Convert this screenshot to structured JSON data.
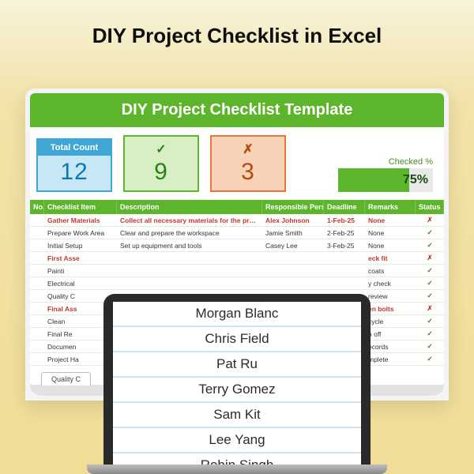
{
  "page": {
    "title": "DIY Project Checklist in Excel"
  },
  "spreadsheet": {
    "banner": "DIY Project Checklist Template",
    "stats": {
      "total": {
        "label": "Total Count",
        "value": "12"
      },
      "checked": {
        "symbol": "✓",
        "value": "9"
      },
      "unchecked": {
        "symbol": "✗",
        "value": "3"
      },
      "percent": {
        "label": "Checked %",
        "value": "75%",
        "fill_pct": 75
      }
    },
    "columns": {
      "no": "No.",
      "item": "Checklist Item",
      "desc": "Description",
      "resp": "Responsible Person",
      "dead": "Deadline",
      "rem": "Remarks",
      "stat": "Status"
    },
    "rows": [
      {
        "red": true,
        "item": "Gather Materials",
        "desc": "Collect all necessary materials for the project",
        "resp": "Alex Johnson",
        "dead": "1-Feb-25",
        "rem": "None",
        "stat": "✗"
      },
      {
        "red": false,
        "item": "Prepare Work Area",
        "desc": "Clear and prepare the workspace",
        "resp": "Jamie Smith",
        "dead": "2-Feb-25",
        "rem": "None",
        "stat": "✓"
      },
      {
        "red": false,
        "item": "Initial Setup",
        "desc": "Set up equipment and tools",
        "resp": "Casey Lee",
        "dead": "3-Feb-25",
        "rem": "None",
        "stat": "✓"
      },
      {
        "red": true,
        "item": "First Asse",
        "desc": "",
        "resp": "",
        "dead": "",
        "rem": "eck fit",
        "stat": "✗"
      },
      {
        "red": false,
        "item": "Painti",
        "desc": "",
        "resp": "",
        "dead": "",
        "rem": "coats",
        "stat": "✓"
      },
      {
        "red": false,
        "item": "Electrical",
        "desc": "",
        "resp": "",
        "dead": "",
        "rem": "y check",
        "stat": "✓"
      },
      {
        "red": false,
        "item": "Quality C",
        "desc": "",
        "resp": "",
        "dead": "",
        "rem": "review",
        "stat": "✓"
      },
      {
        "red": true,
        "item": "Final Ass",
        "desc": "",
        "resp": "",
        "dead": "",
        "rem": "en bolts",
        "stat": "✗"
      },
      {
        "red": false,
        "item": "Clean",
        "desc": "",
        "resp": "",
        "dead": "",
        "rem": "cycle",
        "stat": "✓"
      },
      {
        "red": false,
        "item": "Final Re",
        "desc": "",
        "resp": "",
        "dead": "",
        "rem": "n off",
        "stat": "✓"
      },
      {
        "red": false,
        "item": "Documen",
        "desc": "",
        "resp": "",
        "dead": "",
        "rem": "ecords",
        "stat": "✓"
      },
      {
        "red": false,
        "item": "Project Ha",
        "desc": "",
        "resp": "",
        "dead": "",
        "rem": "mplete",
        "stat": "✓"
      }
    ],
    "sheet_tab": "Quality C"
  },
  "laptop": {
    "names": [
      "Morgan Blanc",
      "Chris Field",
      "Pat Ru",
      "Terry Gomez",
      "Sam Kit",
      "Lee Yang",
      "Robin Singh"
    ]
  }
}
